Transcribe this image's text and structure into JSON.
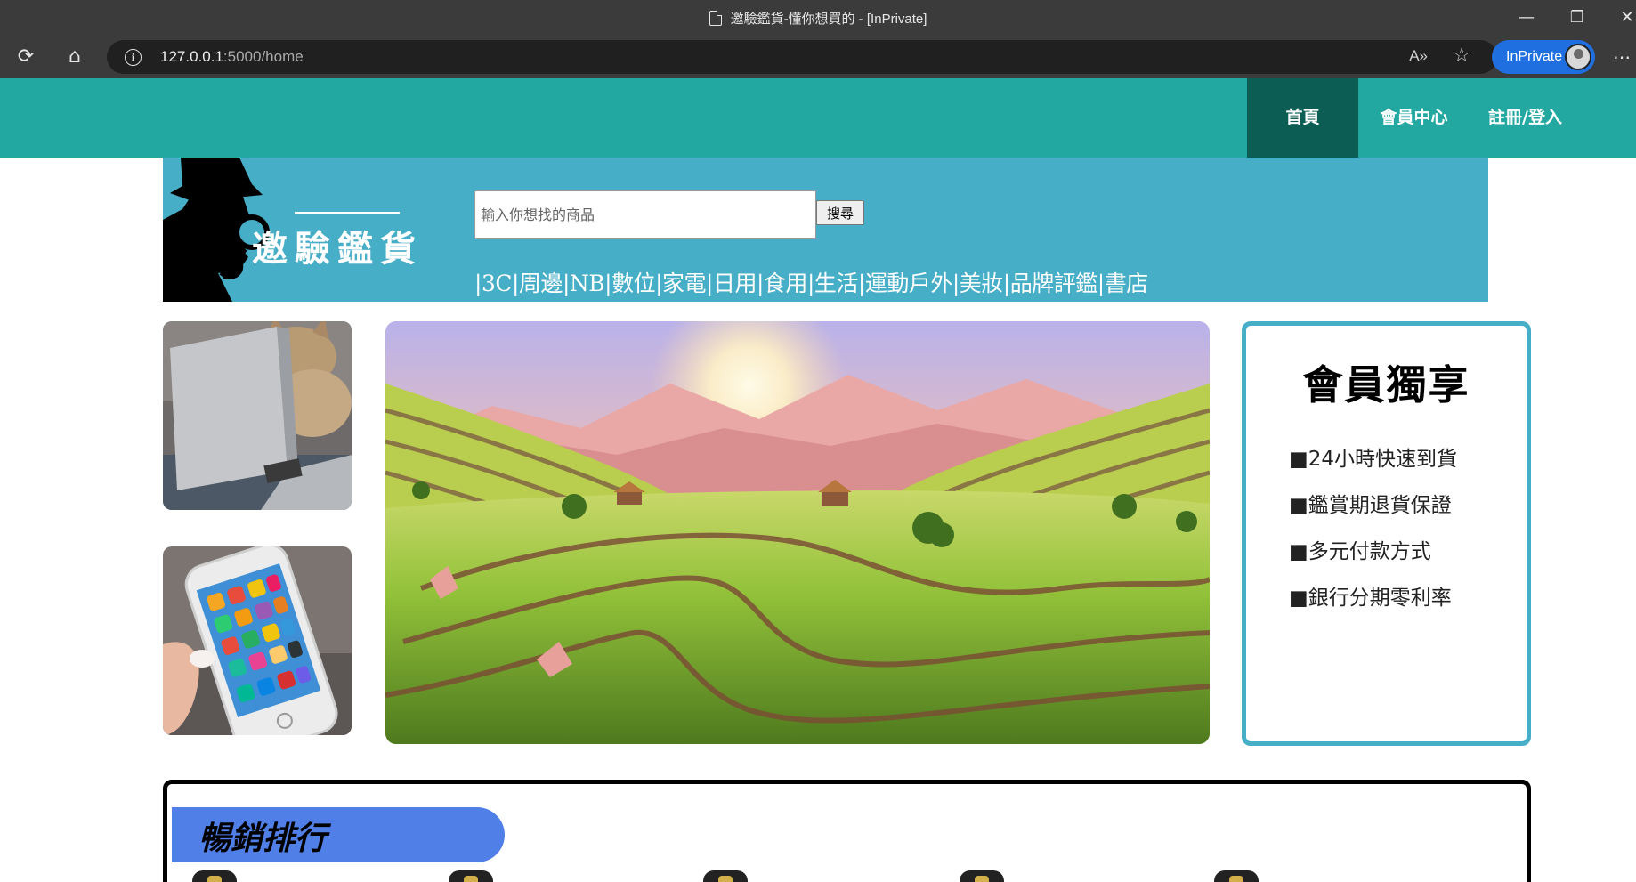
{
  "browser": {
    "window_title": "邀驗鑑貨-懂你想買的 - [InPrivate]",
    "url_host": "127.0.0.1",
    "url_rest": ":5000/home",
    "inprivate_label": "InPrivate",
    "controls": {
      "minimize": "—",
      "maximize": "❐",
      "close": "✕"
    },
    "icons": [
      "reload-icon",
      "home-icon",
      "info-icon",
      "read-aloud-icon",
      "favorites-icon",
      "more-icon"
    ]
  },
  "nav": {
    "items": [
      {
        "label": "首頁",
        "active": true
      },
      {
        "label": "會員中心",
        "active": false
      },
      {
        "label": "註冊/登入",
        "active": false
      }
    ]
  },
  "banner": {
    "logo_text": "邀驗鑑貨",
    "search_placeholder": "輸入你想找的商品",
    "search_button": "搜尋",
    "categories": [
      "3C",
      "周邊",
      "NB",
      "數位",
      "家電",
      "日用",
      "食用",
      "生活",
      "運動戶外",
      "美妝",
      "品牌評鑑",
      "書店"
    ]
  },
  "member_exclusive": {
    "title": "會員獨享",
    "items": [
      "■24小時快速到貨",
      "■鑑賞期退貨保證",
      "■多元付款方式",
      "■銀行分期零利率"
    ]
  },
  "bestseller": {
    "title": "暢銷排行"
  },
  "colors": {
    "navbar": "#22a7a1",
    "nav_active": "#0c5e55",
    "banner": "#47aec7",
    "member_border": "#47aec7",
    "bestseller_tab": "#4f7fe7",
    "inprivate": "#1f6fe0"
  }
}
